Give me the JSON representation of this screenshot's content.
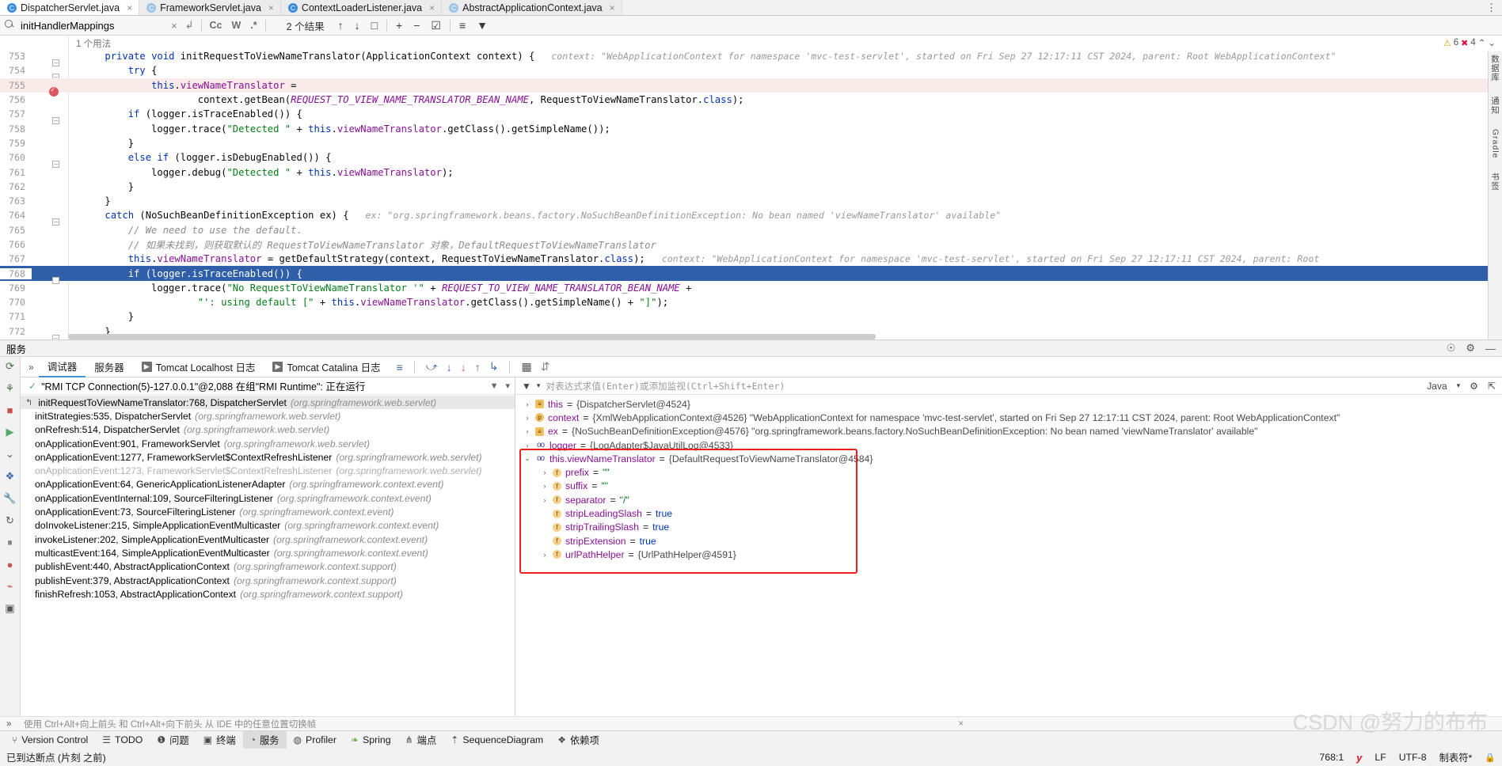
{
  "tabs": [
    {
      "label": "DispatcherServlet.java",
      "icon": "class-icon",
      "active": true
    },
    {
      "label": "FrameworkServlet.java",
      "icon": "class-icon",
      "active": false
    },
    {
      "label": "ContextLoaderListener.java",
      "icon": "class-icon",
      "active": false
    },
    {
      "label": "AbstractApplicationContext.java",
      "icon": "class-icon",
      "active": false
    }
  ],
  "findbar": {
    "query": "initHandlerMappings",
    "clear": "×",
    "history": "↲",
    "case_sensitive": "Cc",
    "words": "W",
    "regex": ".*",
    "results": "2 个结果",
    "prev": "↑",
    "next": "↓",
    "select_all": "□",
    "add_inc": "+",
    "add_exc": "−",
    "add_sel": "☑",
    "lines": "≡",
    "filter": "filter-icon"
  },
  "editor": {
    "breadcrumb": "1 个用法",
    "warnings": "6",
    "errors": "4",
    "warn_icon": "warning-triangle-icon",
    "err_icon": "error-icon",
    "lines": [
      {
        "n": "753",
        "fold": true,
        "hl": "",
        "segments": [
          {
            "t": "    ",
            "c": "plain"
          },
          {
            "t": "private ",
            "c": "kw"
          },
          {
            "t": "void ",
            "c": "kw"
          },
          {
            "t": "initRequestToViewNameTranslator(ApplicationContext context) {",
            "c": "plain"
          },
          {
            "t": "   context: \"WebApplicationContext for namespace 'mvc-test-servlet', started on Fri Sep 27 12:17:11 CST 2024, parent: Root WebApplicationContext\"",
            "c": "hint"
          }
        ]
      },
      {
        "n": "754",
        "fold": true,
        "hl": "",
        "segments": [
          {
            "t": "        ",
            "c": "plain"
          },
          {
            "t": "try ",
            "c": "kw"
          },
          {
            "t": "{",
            "c": "plain"
          }
        ]
      },
      {
        "n": "755",
        "fold": false,
        "bp": true,
        "hl": "pink",
        "segments": [
          {
            "t": "            ",
            "c": "plain"
          },
          {
            "t": "this",
            "c": "kw"
          },
          {
            "t": ".",
            "c": "plain"
          },
          {
            "t": "viewNameTranslator",
            "c": "field"
          },
          {
            "t": " =",
            "c": "plain"
          }
        ]
      },
      {
        "n": "756",
        "fold": false,
        "hl": "",
        "segments": [
          {
            "t": "                    context.getBean(",
            "c": "plain"
          },
          {
            "t": "REQUEST_TO_VIEW_NAME_TRANSLATOR_BEAN_NAME",
            "c": "static"
          },
          {
            "t": ", RequestToViewNameTranslator.",
            "c": "plain"
          },
          {
            "t": "class",
            "c": "kw"
          },
          {
            "t": ");",
            "c": "plain"
          }
        ]
      },
      {
        "n": "757",
        "fold": true,
        "hl": "",
        "segments": [
          {
            "t": "        ",
            "c": "plain"
          },
          {
            "t": "if ",
            "c": "kw"
          },
          {
            "t": "(logger.isTraceEnabled()) {",
            "c": "plain"
          }
        ]
      },
      {
        "n": "758",
        "fold": false,
        "hl": "",
        "segments": [
          {
            "t": "            logger.trace(",
            "c": "plain"
          },
          {
            "t": "\"Detected \"",
            "c": "str"
          },
          {
            "t": " + ",
            "c": "plain"
          },
          {
            "t": "this",
            "c": "kw"
          },
          {
            "t": ".",
            "c": "plain"
          },
          {
            "t": "viewNameTranslator",
            "c": "field"
          },
          {
            "t": ".getClass().getSimpleName());",
            "c": "plain"
          }
        ]
      },
      {
        "n": "759",
        "fold": false,
        "hl": "",
        "segments": [
          {
            "t": "        }",
            "c": "plain"
          }
        ]
      },
      {
        "n": "760",
        "fold": true,
        "hl": "",
        "segments": [
          {
            "t": "        ",
            "c": "plain"
          },
          {
            "t": "else if ",
            "c": "kw"
          },
          {
            "t": "(logger.isDebugEnabled()) {",
            "c": "plain"
          }
        ]
      },
      {
        "n": "761",
        "fold": false,
        "hl": "",
        "segments": [
          {
            "t": "            logger.debug(",
            "c": "plain"
          },
          {
            "t": "\"Detected \"",
            "c": "str"
          },
          {
            "t": " + ",
            "c": "plain"
          },
          {
            "t": "this",
            "c": "kw"
          },
          {
            "t": ".",
            "c": "plain"
          },
          {
            "t": "viewNameTranslator",
            "c": "field"
          },
          {
            "t": ");",
            "c": "plain"
          }
        ]
      },
      {
        "n": "762",
        "fold": false,
        "hl": "",
        "segments": [
          {
            "t": "        }",
            "c": "plain"
          }
        ]
      },
      {
        "n": "763",
        "fold": false,
        "hl": "",
        "segments": [
          {
            "t": "    }",
            "c": "plain"
          }
        ]
      },
      {
        "n": "764",
        "fold": true,
        "hl": "",
        "segments": [
          {
            "t": "    ",
            "c": "plain"
          },
          {
            "t": "catch ",
            "c": "kw"
          },
          {
            "t": "(NoSuchBeanDefinitionException ex) {",
            "c": "plain"
          },
          {
            "t": "   ex: \"org.springframework.beans.factory.NoSuchBeanDefinitionException: No bean named 'viewNameTranslator' available\"",
            "c": "hint"
          }
        ]
      },
      {
        "n": "765",
        "fold": false,
        "hl": "",
        "segments": [
          {
            "t": "        // We need to use the default.",
            "c": "cmt"
          }
        ]
      },
      {
        "n": "766",
        "fold": false,
        "hl": "",
        "segments": [
          {
            "t": "        // 如果未找到，则获取默认的 RequestToViewNameTranslator 对象，DefaultRequestToViewNameTranslator",
            "c": "cmt"
          }
        ]
      },
      {
        "n": "767",
        "fold": false,
        "hl": "",
        "segments": [
          {
            "t": "        ",
            "c": "plain"
          },
          {
            "t": "this",
            "c": "kw"
          },
          {
            "t": ".",
            "c": "plain"
          },
          {
            "t": "viewNameTranslator",
            "c": "field"
          },
          {
            "t": " = getDefaultStrategy(context, RequestToViewNameTranslator.",
            "c": "plain"
          },
          {
            "t": "class",
            "c": "kw"
          },
          {
            "t": ");",
            "c": "plain"
          },
          {
            "t": "   context: \"WebApplicationContext for namespace 'mvc-test-servlet', started on Fri Sep 27 12:17:11 CST 2024, parent: Root",
            "c": "hint"
          }
        ]
      },
      {
        "n": "768",
        "fold": true,
        "hl": "blue",
        "segments": [
          {
            "t": "        ",
            "c": "plain"
          },
          {
            "t": "if ",
            "c": "kw"
          },
          {
            "t": "(logger.isTraceEnabled()) {",
            "c": "plain"
          }
        ]
      },
      {
        "n": "769",
        "fold": false,
        "hl": "",
        "segments": [
          {
            "t": "            logger.trace(",
            "c": "plain"
          },
          {
            "t": "\"No RequestToViewNameTranslator '\"",
            "c": "str"
          },
          {
            "t": " + ",
            "c": "plain"
          },
          {
            "t": "REQUEST_TO_VIEW_NAME_TRANSLATOR_BEAN_NAME",
            "c": "static"
          },
          {
            "t": " +",
            "c": "plain"
          }
        ]
      },
      {
        "n": "770",
        "fold": false,
        "hl": "",
        "segments": [
          {
            "t": "                    ",
            "c": "plain"
          },
          {
            "t": "\"': using default [\"",
            "c": "str"
          },
          {
            "t": " + ",
            "c": "plain"
          },
          {
            "t": "this",
            "c": "kw"
          },
          {
            "t": ".",
            "c": "plain"
          },
          {
            "t": "viewNameTranslator",
            "c": "field"
          },
          {
            "t": ".getClass().getSimpleName() + ",
            "c": "plain"
          },
          {
            "t": "\"]\"",
            "c": "str"
          },
          {
            "t": ");",
            "c": "plain"
          }
        ]
      },
      {
        "n": "771",
        "fold": false,
        "hl": "",
        "segments": [
          {
            "t": "        }",
            "c": "plain"
          }
        ]
      },
      {
        "n": "772",
        "fold": true,
        "hl": "",
        "segments": [
          {
            "t": "    }",
            "c": "plain"
          }
        ]
      }
    ]
  },
  "right_rail": [
    "数据库",
    "通知",
    "Gradle",
    "书签"
  ],
  "services": {
    "title": "服务",
    "settings_icon": "gear-icon",
    "hide_icon": "minimize-icon",
    "help_icon": "help-icon",
    "layout_icon": "layout-icon"
  },
  "debug": {
    "tabs": [
      {
        "label": "调试器",
        "active": true,
        "icon": ""
      },
      {
        "label": "服务器",
        "active": false,
        "icon": ""
      },
      {
        "label": "Tomcat Localhost 日志",
        "active": false,
        "icon": "run-icon"
      },
      {
        "label": "Tomcat Catalina 日志",
        "active": false,
        "icon": "run-icon"
      }
    ],
    "tools": [
      "≡",
      "⤴",
      "↓",
      "↓",
      "↑",
      "↳",
      "▦",
      "⇅"
    ],
    "thread": "\"RMI TCP Connection(5)-127.0.0.1\"@2,088 在组\"RMI Runtime\": 正在运行",
    "thread_filter_icon": "filter-icon",
    "thread_dropdown": "▾",
    "frames": [
      {
        "text": "initRequestToViewNameTranslator:768, DispatcherServlet",
        "pkg": "(org.springframework.web.servlet)",
        "sel": true,
        "muted": false
      },
      {
        "text": "initStrategies:535, DispatcherServlet",
        "pkg": "(org.springframework.web.servlet)",
        "sel": false,
        "muted": false
      },
      {
        "text": "onRefresh:514, DispatcherServlet",
        "pkg": "(org.springframework.web.servlet)",
        "sel": false,
        "muted": false
      },
      {
        "text": "onApplicationEvent:901, FrameworkServlet",
        "pkg": "(org.springframework.web.servlet)",
        "sel": false,
        "muted": false
      },
      {
        "text": "onApplicationEvent:1277, FrameworkServlet$ContextRefreshListener",
        "pkg": "(org.springframework.web.servlet)",
        "sel": false,
        "muted": false
      },
      {
        "text": "onApplicationEvent:1273, FrameworkServlet$ContextRefreshListener",
        "pkg": "(org.springframework.web.servlet)",
        "sel": false,
        "muted": true
      },
      {
        "text": "onApplicationEvent:64, GenericApplicationListenerAdapter",
        "pkg": "(org.springframework.context.event)",
        "sel": false,
        "muted": false
      },
      {
        "text": "onApplicationEventInternal:109, SourceFilteringListener",
        "pkg": "(org.springframework.context.event)",
        "sel": false,
        "muted": false
      },
      {
        "text": "onApplicationEvent:73, SourceFilteringListener",
        "pkg": "(org.springframework.context.event)",
        "sel": false,
        "muted": false
      },
      {
        "text": "doInvokeListener:215, SimpleApplicationEventMulticaster",
        "pkg": "(org.springframework.context.event)",
        "sel": false,
        "muted": false
      },
      {
        "text": "invokeListener:202, SimpleApplicationEventMulticaster",
        "pkg": "(org.springframework.context.event)",
        "sel": false,
        "muted": false
      },
      {
        "text": "multicastEvent:164, SimpleApplicationEventMulticaster",
        "pkg": "(org.springframework.context.event)",
        "sel": false,
        "muted": false
      },
      {
        "text": "publishEvent:440, AbstractApplicationContext",
        "pkg": "(org.springframework.context.support)",
        "sel": false,
        "muted": false
      },
      {
        "text": "publishEvent:379, AbstractApplicationContext",
        "pkg": "(org.springframework.context.support)",
        "sel": false,
        "muted": false
      },
      {
        "text": "finishRefresh:1053, AbstractApplicationContext",
        "pkg": "(org.springframework.context.support)",
        "sel": false,
        "muted": false
      }
    ]
  },
  "watch": {
    "placeholder": "对表达式求值(Enter)或添加监视(Ctrl+Shift+Enter)",
    "filter_icon": "filter-icon",
    "dropdown": "▾",
    "language": "Java",
    "lang_caret": "▾",
    "settings_icon": "gear-icon",
    "expand_icon": "expand-icon"
  },
  "variables": [
    {
      "indent": 0,
      "arrow": "›",
      "badge": "obj",
      "badge_text": "≡",
      "name": "this",
      "eq": " = ",
      "value": "{DispatcherServlet@4524}",
      "vclass": "vval"
    },
    {
      "indent": 0,
      "arrow": "›",
      "badge": "p",
      "badge_text": "p",
      "name": "context",
      "eq": " = ",
      "value": "{XmlWebApplicationContext@4526} \"WebApplicationContext for namespace 'mvc-test-servlet', started on Fri Sep 27 12:17:11 CST 2024, parent: Root WebApplicationContext\"",
      "vclass": "vval"
    },
    {
      "indent": 0,
      "arrow": "›",
      "badge": "obj",
      "badge_text": "≡",
      "name": "ex",
      "eq": " = ",
      "value": "{NoSuchBeanDefinitionException@4576} \"org.springframework.beans.factory.NoSuchBeanDefinitionException: No bean named 'viewNameTranslator' available\"",
      "vclass": "vval"
    },
    {
      "indent": 0,
      "arrow": "›",
      "badge": "oo",
      "badge_text": "oo",
      "name": "logger",
      "eq": " = ",
      "value": "{LogAdapter$JavaUtilLog@4533}",
      "vclass": "vval"
    },
    {
      "indent": 0,
      "arrow": "⌄",
      "badge": "oo",
      "badge_text": "oo",
      "name": "this.viewNameTranslator",
      "eq": " = ",
      "value": "{DefaultRequestToViewNameTranslator@4584}",
      "vclass": "vval"
    },
    {
      "indent": 1,
      "arrow": "›",
      "badge": "f",
      "badge_text": "f",
      "name": "prefix",
      "eq": " = ",
      "value": "\"\"",
      "vclass": "vstr"
    },
    {
      "indent": 1,
      "arrow": "›",
      "badge": "f",
      "badge_text": "f",
      "name": "suffix",
      "eq": " = ",
      "value": "\"\"",
      "vclass": "vstr"
    },
    {
      "indent": 1,
      "arrow": "›",
      "badge": "f",
      "badge_text": "f",
      "name": "separator",
      "eq": " = ",
      "value": "\"/\"",
      "vclass": "vstr"
    },
    {
      "indent": 1,
      "arrow": "",
      "badge": "f",
      "badge_text": "f",
      "name": "stripLeadingSlash",
      "eq": " = ",
      "value": "true",
      "vclass": "vbool"
    },
    {
      "indent": 1,
      "arrow": "",
      "badge": "f",
      "badge_text": "f",
      "name": "stripTrailingSlash",
      "eq": " = ",
      "value": "true",
      "vclass": "vbool"
    },
    {
      "indent": 1,
      "arrow": "",
      "badge": "f",
      "badge_text": "f",
      "name": "stripExtension",
      "eq": " = ",
      "value": "true",
      "vclass": "vbool"
    },
    {
      "indent": 1,
      "arrow": "›",
      "badge": "f",
      "badge_text": "f",
      "name": "urlPathHelper",
      "eq": " = ",
      "value": "{UrlPathHelper@4591}",
      "vclass": "vval"
    }
  ],
  "hint": {
    "text": "使用 Ctrl+Alt+向上前头 和 Ctrl+Alt+向下前头 从 IDE 中的任意位置切换帧",
    "close": "×",
    "expand": "»"
  },
  "statusbar": [
    {
      "label": "Version Control",
      "icon": "branch-icon",
      "active": false
    },
    {
      "label": "TODO",
      "icon": "todo-icon",
      "active": false
    },
    {
      "label": "问题",
      "icon": "problems-icon",
      "active": false
    },
    {
      "label": "终端",
      "icon": "terminal-icon",
      "active": false
    },
    {
      "label": "服务",
      "icon": "services-icon",
      "active": true
    },
    {
      "label": "Profiler",
      "icon": "profiler-icon",
      "active": false
    },
    {
      "label": "Spring",
      "icon": "spring-leaf-icon",
      "active": false
    },
    {
      "label": "端点",
      "icon": "endpoints-icon",
      "active": false
    },
    {
      "label": "SequenceDiagram",
      "icon": "sequence-icon",
      "active": false
    },
    {
      "label": "依赖项",
      "icon": "dependencies-icon",
      "active": false
    }
  ],
  "bottom": {
    "message": "已到达断点 (片刻 之前)",
    "caret": "768:1",
    "y_badge": "y",
    "line_sep": "LF",
    "encoding": "UTF-8",
    "indent": "制表符*",
    "lock": "lock-icon"
  },
  "watermark": "CSDN @努力的布布"
}
